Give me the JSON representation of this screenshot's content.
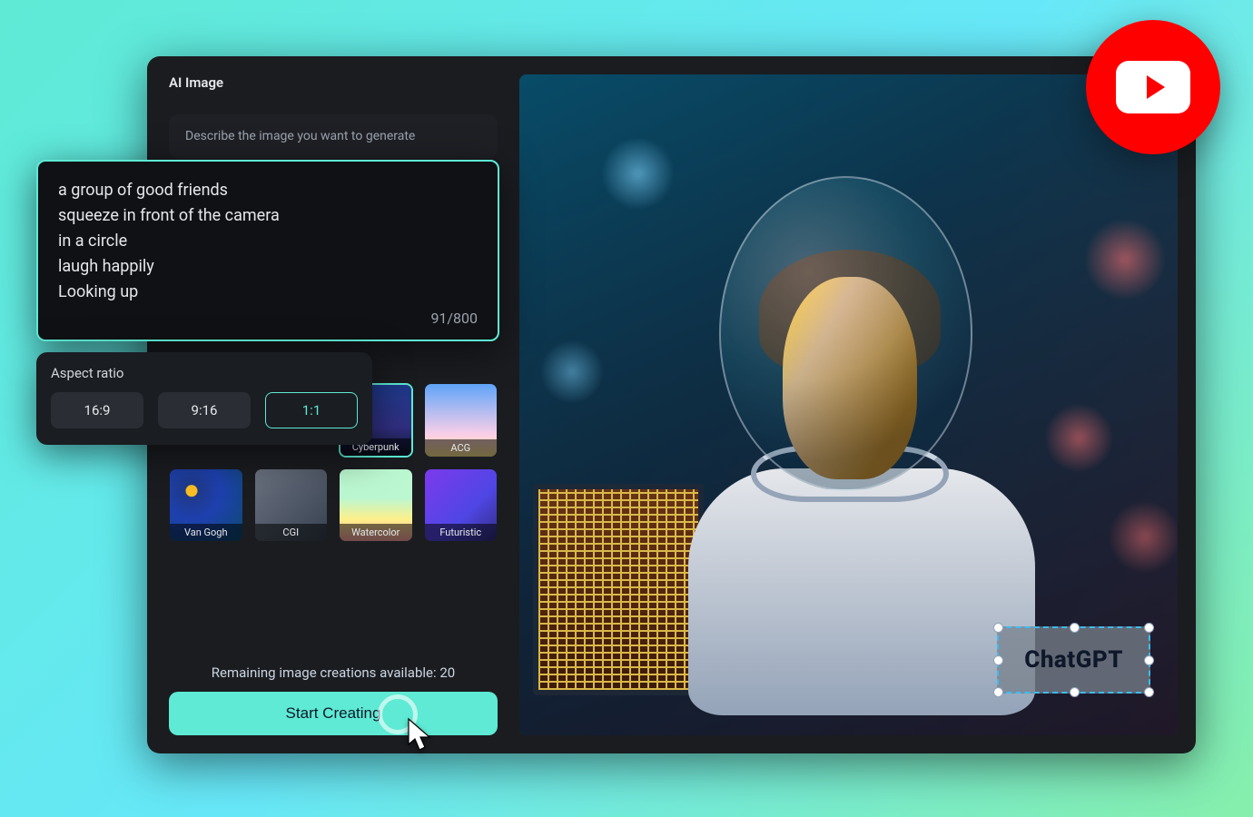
{
  "header": {
    "title": "AI Image"
  },
  "describe": {
    "label": "Describe the image you want to generate"
  },
  "prompt": {
    "text": "a group of good friends\nsqueeze in front of the camera\nin a circle\nlaugh happily\nLooking up",
    "char_count": "91/800"
  },
  "aspect": {
    "title": "Aspect ratio",
    "options": [
      "16:9",
      "9:16",
      "1:1"
    ],
    "selected": "1:1"
  },
  "styles": [
    {
      "key": "cyberpunk",
      "label": "Cyberpunk",
      "css": "cyberpunk-bg",
      "selected": true
    },
    {
      "key": "acg",
      "label": "ACG",
      "css": "acg-bg"
    },
    {
      "key": "vangogh",
      "label": "Van Gogh",
      "css": "vangogh-bg"
    },
    {
      "key": "cgi",
      "label": "CGI",
      "css": "cgi-bg"
    },
    {
      "key": "watercolor",
      "label": "Watercolor",
      "css": "watercolor-bg"
    },
    {
      "key": "futuristic",
      "label": "Futuristic",
      "css": "futuristic-bg"
    }
  ],
  "remaining": {
    "text": "Remaining image creations available: 20"
  },
  "cta": {
    "label": "Start Creating"
  },
  "overlay_textbox": {
    "label": "ChatGPT"
  },
  "colors": {
    "accent": "#5eead4",
    "app_bg": "#1a1c20",
    "youtube": "#ff0000"
  }
}
